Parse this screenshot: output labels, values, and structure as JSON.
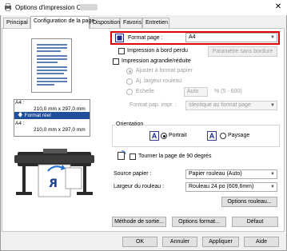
{
  "window": {
    "title": "Options d'impression Canon",
    "close_glyph": "✕"
  },
  "tabs": [
    {
      "label": "Principal"
    },
    {
      "label": "Configuration de la page"
    },
    {
      "label": "Disposition"
    },
    {
      "label": "Favoris"
    },
    {
      "label": "Entretien"
    }
  ],
  "preview_info": {
    "line1_label": "A4 :",
    "line1_size": "210,0 mm x 297,0 mm",
    "bar_label": "Format réel",
    "line2_label": "A4 :",
    "line2_size": "210,0 mm x 297,0 mm",
    "preview_letter": "R"
  },
  "page_size": {
    "label": "Format page :",
    "value": "A4"
  },
  "borderless": {
    "label": "Impression à bord perdu",
    "checked": false,
    "button": "Paramètre sans bordure"
  },
  "scaled": {
    "label": "Impression agrandie/réduite",
    "checked": false,
    "fit_paper": "Ajuster à format papier",
    "fit_roll": "Aj. largeur rouleau",
    "scale": "Echelle",
    "scale_value": "Auto",
    "scale_unit": "% (5 - 600)",
    "paper_format_label": "Format pap. impr. :",
    "paper_format_value": "Identique au format page"
  },
  "orientation": {
    "title": "Orientation",
    "portrait": "Portrait",
    "landscape": "Paysage",
    "selected": "portrait",
    "portrait_icon": "A",
    "landscape_icon": "A"
  },
  "rotate": {
    "label": "Tourner la page de 90 degrés",
    "checked": false
  },
  "source": {
    "label": "Source papier :",
    "value": "Papier rouleau (Auto)"
  },
  "roll_width": {
    "label": "Largeur du rouleau :",
    "value": "Rouleau 24 po (609,6mm)"
  },
  "buttons": {
    "roll_options": "Options rouleau...",
    "output_method": "Méthode de sortie...",
    "format_options": "Options format...",
    "default": "Défaut",
    "ok": "OK",
    "cancel": "Annuler",
    "apply": "Appliquer",
    "help": "Aide"
  },
  "colors": {
    "accent": "#1f4f9b",
    "highlight": "#e00000"
  }
}
